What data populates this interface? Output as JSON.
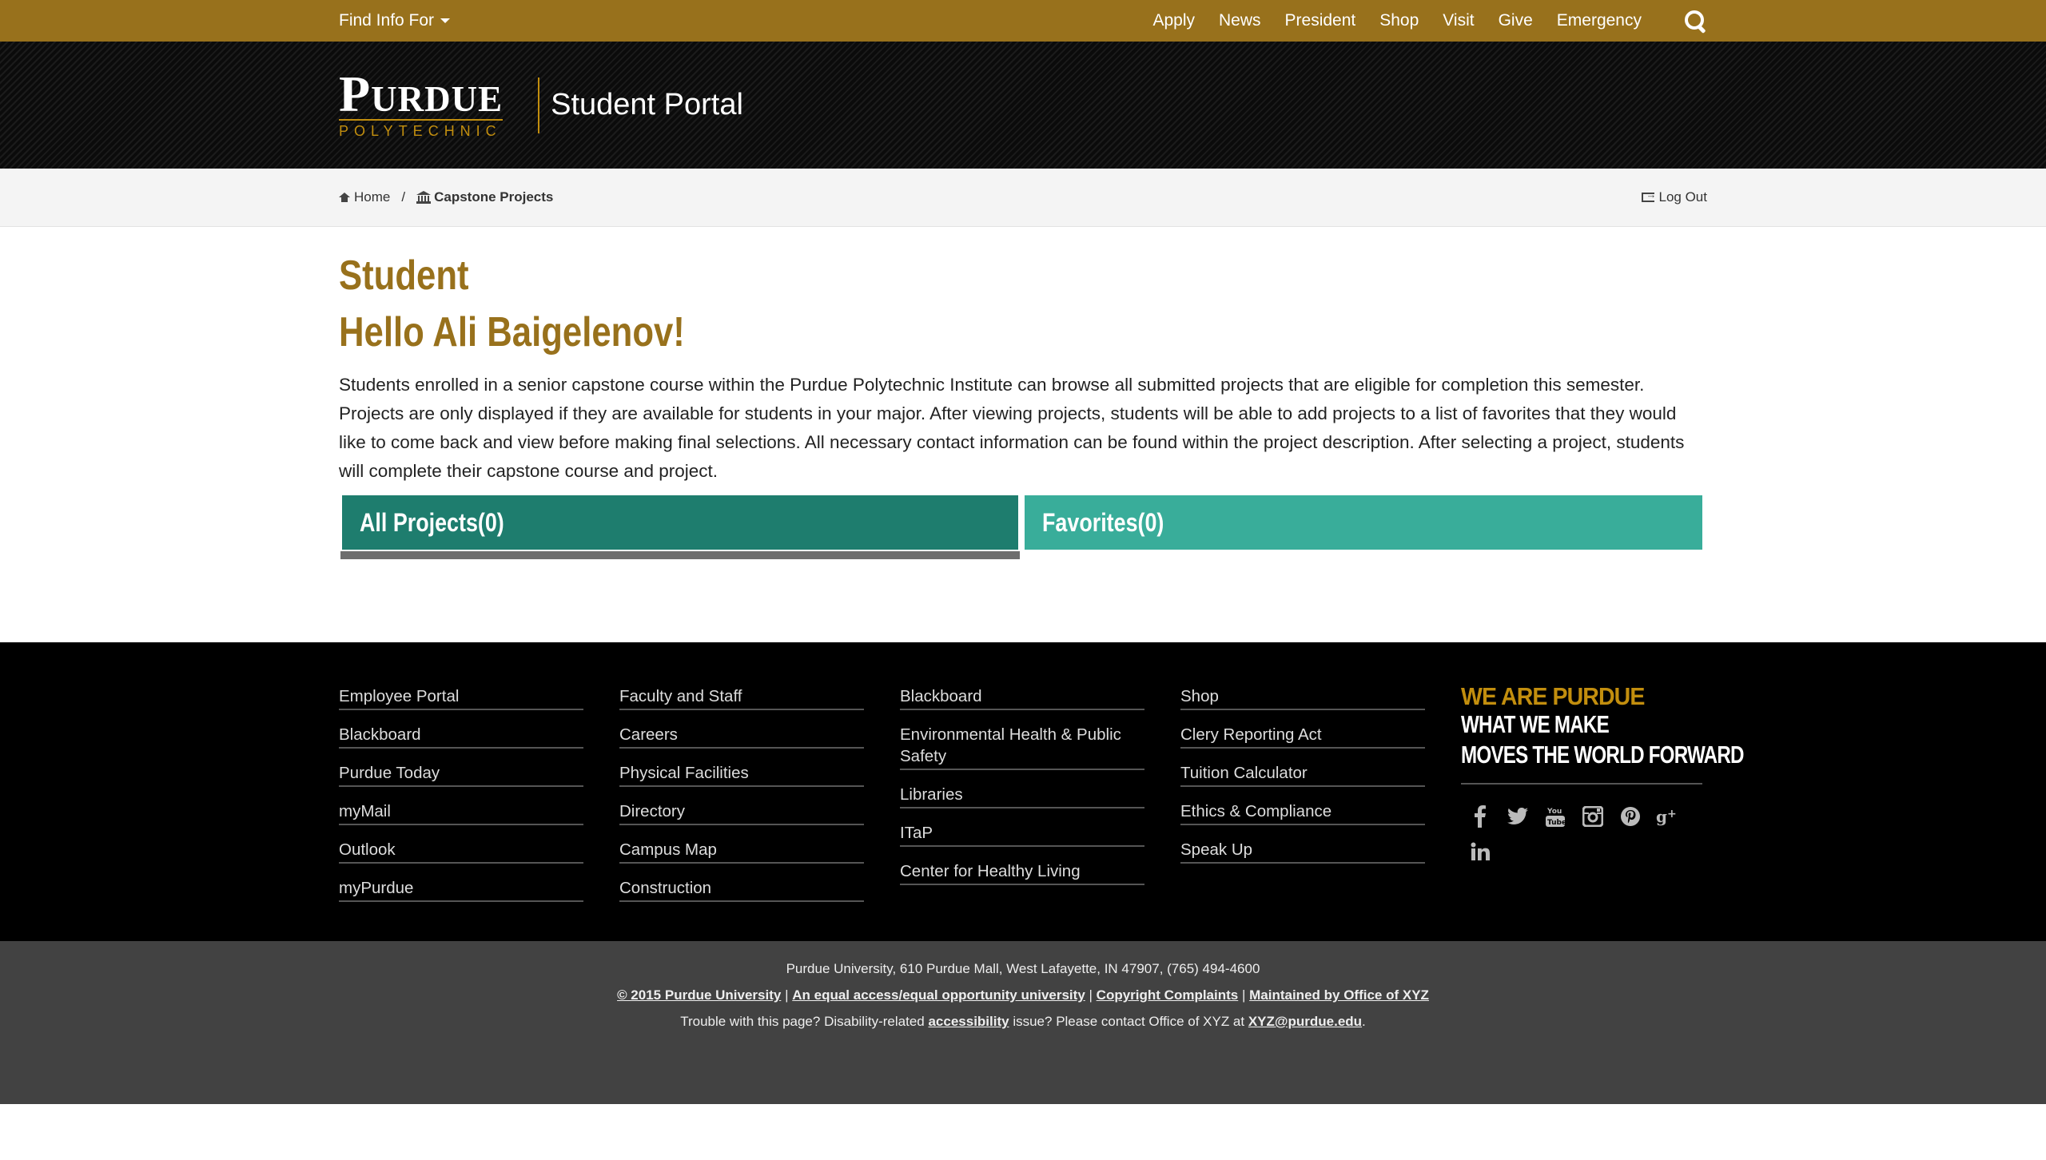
{
  "topbar": {
    "find_info": "Find Info For",
    "links": [
      "Apply",
      "News",
      "President",
      "Shop",
      "Visit",
      "Give",
      "Emergency"
    ]
  },
  "header": {
    "logo_main": "Purdue",
    "logo_sub": "POLYTECHNIC",
    "portal_title": "Student Portal"
  },
  "breadcrumb": {
    "home": "Home",
    "separator": "/",
    "current": "Capstone Projects",
    "logout": "Log Out"
  },
  "main": {
    "role": "Student",
    "greeting": "Hello Ali Baigelenov!",
    "intro": "Students enrolled in a senior capstone course within the Purdue Polytechnic Institute can browse all submitted projects that are eligible for completion this semester. Projects are only displayed if they are available for students in your major. After viewing projects, students will be able to add projects to a list of favorites that they would like to come back and view before making final selections. All necessary contact information can be found within the project description. After selecting a project, students will complete their capstone course and project.",
    "tabs": {
      "all_projects": "All Projects(0)",
      "favorites": "Favorites(0)"
    }
  },
  "footer": {
    "col1": [
      "Employee Portal",
      "Blackboard",
      "Purdue Today",
      "myMail",
      "Outlook",
      "myPurdue"
    ],
    "col2": [
      "Faculty and Staff",
      "Careers",
      "Physical Facilities",
      "Directory",
      "Campus Map",
      "Construction"
    ],
    "col3": [
      "Blackboard",
      "Environmental Health & Public Safety",
      "Libraries",
      "ITaP",
      "Center for Healthy Living"
    ],
    "col4": [
      "Shop",
      "Clery Reporting Act",
      "Tuition Calculator",
      "Ethics & Compliance",
      "Speak Up"
    ],
    "brand": {
      "line1": "WE ARE PURDUE",
      "line2": "WHAT WE MAKE",
      "line3": "MOVES THE WORLD FORWARD"
    },
    "social_icons": [
      "facebook-icon",
      "twitter-icon",
      "youtube-icon",
      "instagram-icon",
      "pinterest-icon",
      "google-plus-icon",
      "linkedin-icon"
    ]
  },
  "bottom": {
    "address": "Purdue University, 610 Purdue Mall, West Lafayette, IN 47907, (765) 494-4600",
    "copyright": "© 2015 Purdue University",
    "equal_access": "An equal access/equal opportunity university",
    "copyright_complaints": "Copyright Complaints",
    "maintained": "Maintained by Office of XYZ",
    "sep": "|",
    "trouble_prefix": "Trouble with this page? Disability-related",
    "accessibility": "accessibility",
    "trouble_suffix": "issue? Please contact Office of XYZ at",
    "email": "XYZ@purdue.edu",
    "period": "."
  },
  "colors": {
    "gold": "#98711c",
    "logo_gold": "#c28e0e",
    "tab_active": "#1e7d6e",
    "tab_inactive": "#39ad9a",
    "footer_bg": "#000000",
    "bottom_bg": "#424242"
  }
}
